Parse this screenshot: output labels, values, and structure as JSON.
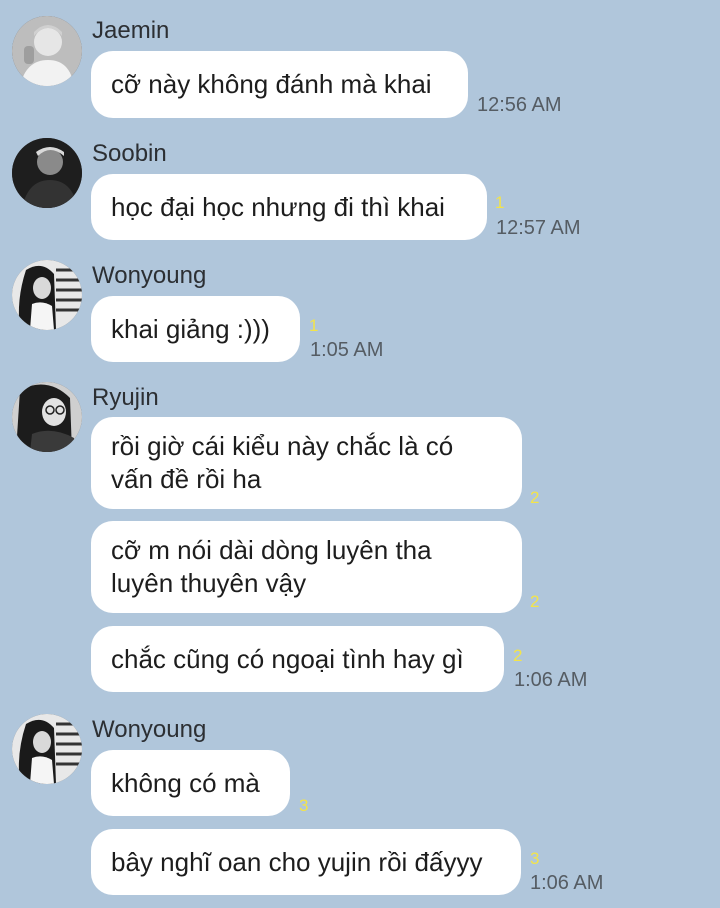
{
  "colors": {
    "background": "#b0c6db",
    "bubble": "#ffffff",
    "unread": "#f3e44a",
    "time": "#555c63"
  },
  "messages": [
    {
      "sender": "Jaemin",
      "text": "cỡ này không đánh mà khai",
      "time": "12:56 AM"
    },
    {
      "sender": "Soobin",
      "text": "học đại học nhưng đi thì khai",
      "unread": "1",
      "time": "12:57 AM"
    },
    {
      "sender": "Wonyoung",
      "text": "khai giảng :)))",
      "unread": "1",
      "time": "1:05 AM"
    },
    {
      "sender": "Ryujin",
      "text": "rồi giờ cái kiểu này chắc là có\nvấn đề rồi ha",
      "unread": "2"
    },
    {
      "text": "cỡ m nói dài dòng luyên tha\nluyên thuyên vậy",
      "unread": "2"
    },
    {
      "text": "chắc cũng có ngoại tình hay gì",
      "unread": "2",
      "time": "1:06 AM"
    },
    {
      "sender": "Wonyoung",
      "text": "không có mà",
      "unread": "3"
    },
    {
      "text": "bây nghĩ oan cho yujin rồi đấyyy",
      "unread": "3",
      "time": "1:06 AM"
    }
  ]
}
